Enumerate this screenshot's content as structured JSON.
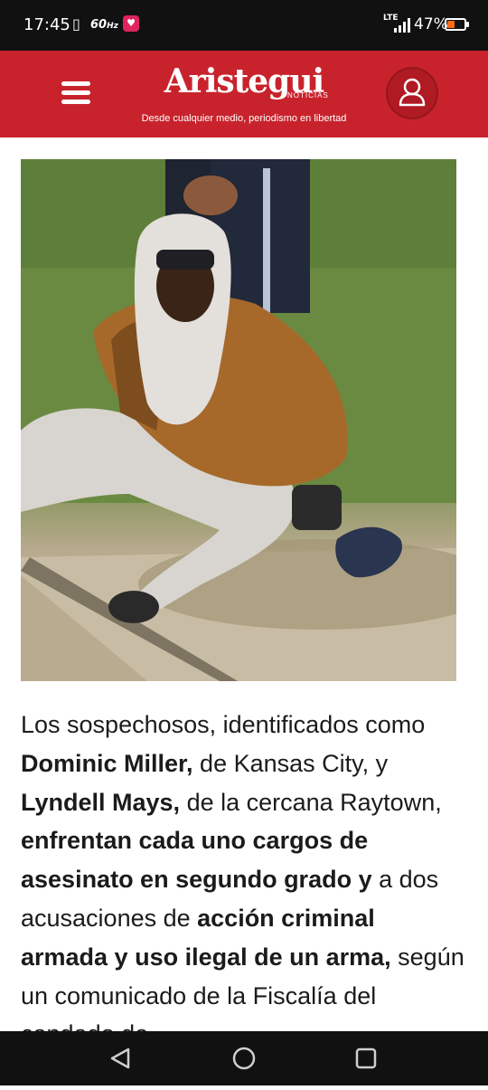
{
  "status_bar": {
    "time": "17:45",
    "refresh_rate": "60",
    "refresh_unit": "Hz",
    "network": "LTE",
    "battery_percent": "47%",
    "battery_level": 0.47,
    "battery_color": "#ff6a1a",
    "icons": [
      "vibrate-icon",
      "health-app-icon",
      "signal-icon",
      "battery-icon"
    ]
  },
  "header": {
    "brand_color": "#c8232c",
    "logo_text": "Aristegui",
    "logo_sub": "NOTICIAS",
    "tagline": "Desde cualquier medio, periodismo en libertad",
    "menu_icon": "hamburger-menu-icon",
    "user_icon": "user-profile-icon"
  },
  "article": {
    "image_description_icon": "article-photo",
    "paragraph": [
      {
        "text": "Los sospechosos, identificados como ",
        "bold": false
      },
      {
        "text": "Dominic Miller,",
        "bold": true
      },
      {
        "text": " de Kansas City, y ",
        "bold": false
      },
      {
        "text": "Lyndell Mays,",
        "bold": true
      },
      {
        "text": " de la cercana Raytown, ",
        "bold": false
      },
      {
        "text": "enfrentan cada uno cargos de asesinato en segundo grado y",
        "bold": true
      },
      {
        "text": " a dos acusaciones de ",
        "bold": false
      },
      {
        "text": "acción criminal armada y uso ilegal de un arma,",
        "bold": true
      },
      {
        "text": " según un comunicado de la Fiscalía del condado de",
        "bold": false
      }
    ]
  },
  "nav_bar": {
    "buttons": [
      "back-icon",
      "home-icon",
      "recents-icon"
    ]
  }
}
